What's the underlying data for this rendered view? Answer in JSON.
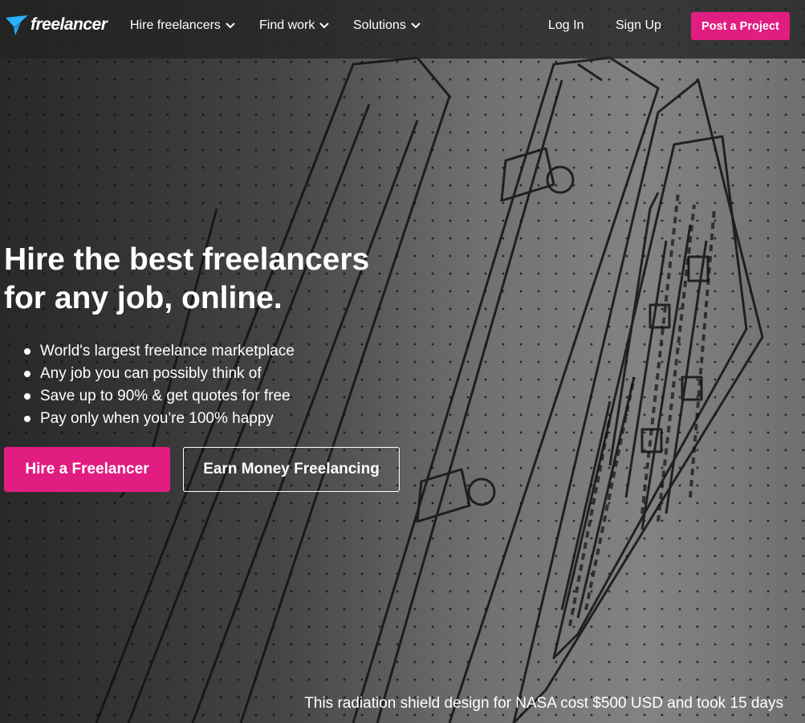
{
  "brand": {
    "name": "freelancer",
    "logo_icon": "bird-logo-icon",
    "accent_color": "#29b2fe"
  },
  "nav": {
    "items": [
      {
        "label": "Hire freelancers",
        "icon": "chevron-down-icon"
      },
      {
        "label": "Find work",
        "icon": "chevron-down-icon"
      },
      {
        "label": "Solutions",
        "icon": "chevron-down-icon"
      }
    ],
    "login_label": "Log In",
    "signup_label": "Sign Up",
    "post_project_label": "Post a Project"
  },
  "hero": {
    "headline_line1": "Hire the best freelancers",
    "headline_line2": "for any job, online.",
    "bullets": [
      "World's largest freelance marketplace",
      "Any job you can possibly think of",
      "Save up to 90% & get quotes for free",
      "Pay only when you're 100% happy"
    ],
    "hire_button_label": "Hire a Freelancer",
    "earn_button_label": "Earn Money Freelancing",
    "caption": "This radiation shield design for NASA cost $500 USD and took 15 days"
  },
  "colors": {
    "primary_pink": "#e11d81",
    "nav_background": "#232323"
  }
}
